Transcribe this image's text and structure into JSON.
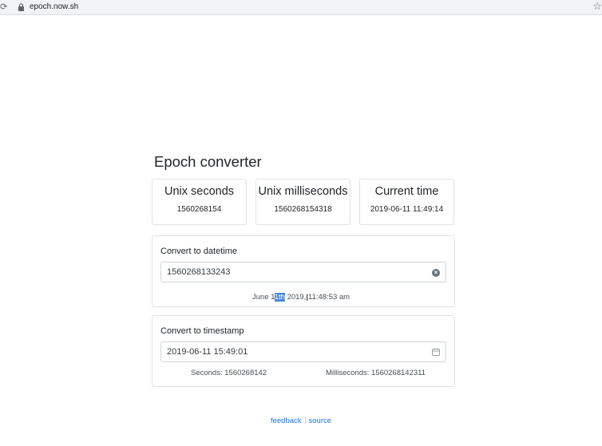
{
  "browser": {
    "url": "epoch.now.sh",
    "reload_glyph": "⟳",
    "star_glyph": "☆"
  },
  "page": {
    "title": "Epoch converter"
  },
  "cards": [
    {
      "title": "Unix seconds",
      "value": "1560268154"
    },
    {
      "title": "Unix milliseconds",
      "value": "1560268154318"
    },
    {
      "title": "Current time",
      "value": "2019-06-11 11:49:14"
    }
  ],
  "to_datetime": {
    "title": "Convert to datetime",
    "input_value": "1560268133243",
    "clear_glyph": "×",
    "result_before": "June 1",
    "result_selected": "1th",
    "result_after": " 2019, 11:48:53 am"
  },
  "to_timestamp": {
    "title": "Convert to timestamp",
    "input_value": "2019-06-11 15:49:01",
    "seconds_text": "Seconds: 1560268142",
    "milliseconds_text": "Milliseconds: 1560268142311"
  },
  "footer": {
    "feedback_label": "feedback",
    "source_label": "source"
  },
  "colors": {
    "link": "#1a73e8",
    "selection": "#4a89dc",
    "border": "#dfe2e5"
  },
  "icons": [
    "reload-icon",
    "lock-icon",
    "star-icon",
    "clear-icon",
    "calendar-icon",
    "text-cursor-icon"
  ]
}
